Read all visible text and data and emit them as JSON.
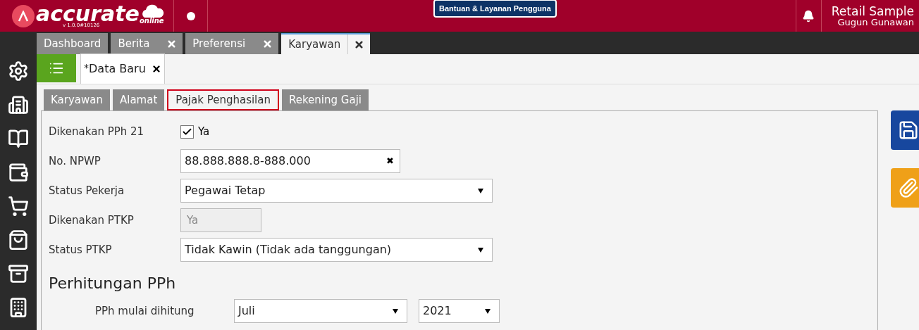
{
  "header": {
    "logo_text": "accurate",
    "logo_sub": "online",
    "version": "v 1.0.0#10126",
    "help_button": "Bantuan & Layanan Pengguna",
    "company": "Retail Sample",
    "user": "Gugun Gunawan"
  },
  "module_tabs": [
    {
      "label": "Dashboard",
      "closable": false,
      "selected": false
    },
    {
      "label": "Berita",
      "closable": true,
      "selected": false
    },
    {
      "label": "Preferensi",
      "closable": true,
      "selected": false
    },
    {
      "label": "Karyawan",
      "closable": true,
      "selected": true
    }
  ],
  "doc_tab": {
    "modified_mark": "*",
    "label": "Data Baru"
  },
  "form_tabs": [
    {
      "label": "Karyawan",
      "selected": false
    },
    {
      "label": "Alamat",
      "selected": false
    },
    {
      "label": "Pajak Penghasilan",
      "selected": true
    },
    {
      "label": "Rekening Gaji",
      "selected": false
    }
  ],
  "fields": [
    {
      "kind": "checkbox",
      "label": "Dikenakan PPh 21",
      "checked": true,
      "value": "Ya"
    },
    {
      "kind": "text",
      "label": "No. NPWP",
      "value": "88.888.888.8-888.000",
      "clear_mark": "✖"
    },
    {
      "kind": "select",
      "label": "Status Pekerja",
      "value": "Pegawai Tetap"
    },
    {
      "kind": "readonly",
      "label": "Dikenakan PTKP",
      "value": "Ya"
    },
    {
      "kind": "select",
      "label": "Status PTKP",
      "value": "Tidak Kawin (Tidak ada tanggungan)"
    }
  ],
  "section": {
    "title": "Perhitungan PPh",
    "label": "PPh mulai dihitung",
    "month": "Juli",
    "year": "2021"
  }
}
